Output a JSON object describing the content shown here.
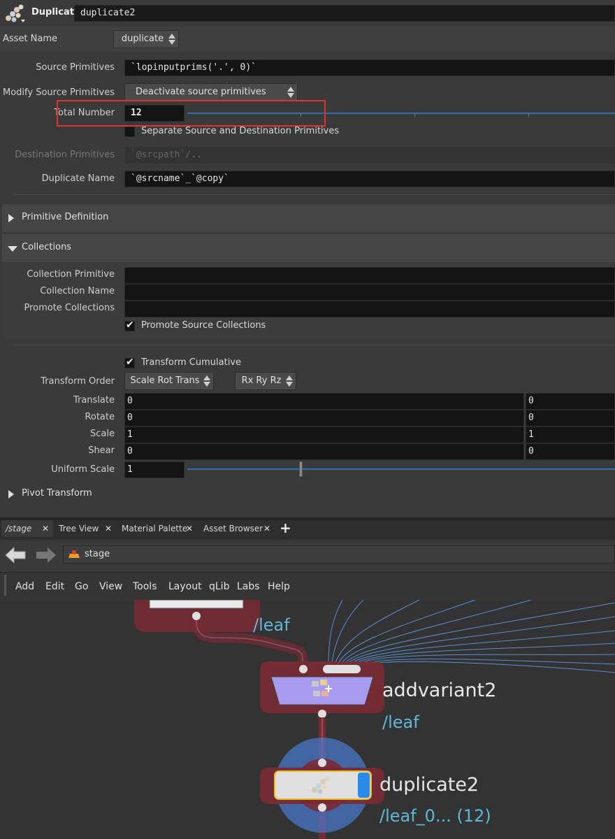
{
  "header": {
    "node_type": "Duplicate",
    "node_name": "duplicate2"
  },
  "asset": {
    "label": "Asset Name",
    "value": "duplicate"
  },
  "params": {
    "source_primitives": {
      "label": "Source Primitives",
      "value": "`lopinputprims('.', 0)`"
    },
    "modify_source": {
      "label": "Modify Source Primitives",
      "value": "Deactivate source primitives"
    },
    "total_number": {
      "label": "Total Number",
      "value": "12"
    },
    "separate": {
      "label": "Separate Source and Destination Primitives",
      "checked": false
    },
    "destination": {
      "label": "Destination Primitives",
      "value": "`@srcpath`/.."
    },
    "duplicate_name": {
      "label": "Duplicate Name",
      "value": "`@srcname`_`@copy`"
    }
  },
  "sections": {
    "primitive_definition": "Primitive Definition",
    "collections": "Collections",
    "pivot_transform": "Pivot Transform"
  },
  "collections": {
    "collection_primitive": {
      "label": "Collection Primitive",
      "value": ""
    },
    "collection_name": {
      "label": "Collection Name",
      "value": ""
    },
    "promote_collections": {
      "label": "Promote Collections",
      "value": ""
    },
    "promote_source": {
      "label": "Promote Source Collections",
      "checked": true
    }
  },
  "transform": {
    "cumulative": {
      "label": "Transform Cumulative",
      "checked": true
    },
    "order": {
      "label": "Transform Order",
      "value": "Scale Rot Trans",
      "rot_value": "Rx Ry Rz"
    },
    "translate": {
      "label": "Translate",
      "x": "0",
      "y": "0"
    },
    "rotate": {
      "label": "Rotate",
      "x": "0",
      "y": "0"
    },
    "scale": {
      "label": "Scale",
      "x": "1",
      "y": "1"
    },
    "shear": {
      "label": "Shear",
      "x": "0",
      "y": "0"
    },
    "uniform_scale": {
      "label": "Uniform Scale",
      "value": "1"
    }
  },
  "tabs": [
    {
      "label": "/stage"
    },
    {
      "label": "Tree View"
    },
    {
      "label": "Material Palette"
    },
    {
      "label": "Asset Browser"
    }
  ],
  "path": {
    "value": "stage"
  },
  "menu": [
    "Add",
    "Edit",
    "Go",
    "View",
    "Tools",
    "Layout",
    "qLib",
    "Labs",
    "Help"
  ],
  "network": {
    "leaf_label": "/leaf",
    "addvariant": {
      "name": "addvariant2",
      "path": "/leaf"
    },
    "duplicate": {
      "name": "duplicate2",
      "path": "/leaf_0... (12)"
    }
  },
  "colors": {
    "accent_blue": "#2f6db5",
    "highlight_red": "#e03030",
    "node_purple": "#a99bf0",
    "wire_blue": "#5a8fd0",
    "label_cyan": "#5fb8d8"
  }
}
